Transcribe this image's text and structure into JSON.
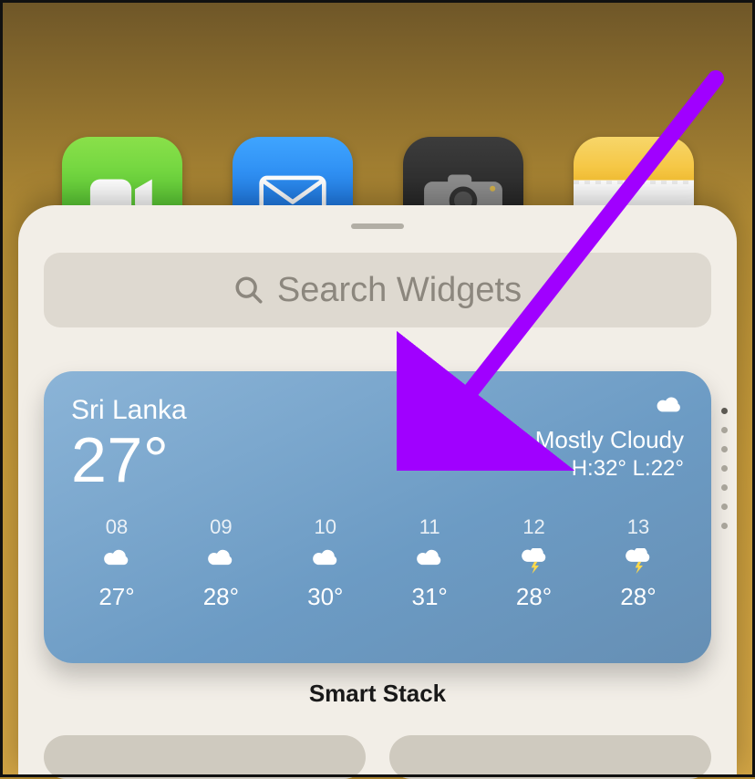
{
  "apps": {
    "facetime": "facetime-icon",
    "mail": "mail-icon",
    "camera": "camera-icon",
    "notes": "notes-icon"
  },
  "search": {
    "placeholder": "Search Widgets"
  },
  "widget": {
    "location": "Sri Lanka",
    "temp": "27°",
    "condition_icon": "cloud",
    "condition": "Mostly Cloudy",
    "hilo": "H:32° L:22°",
    "hours": [
      {
        "label": "08",
        "icon": "cloud",
        "temp": "27°"
      },
      {
        "label": "09",
        "icon": "cloud",
        "temp": "28°"
      },
      {
        "label": "10",
        "icon": "cloud",
        "temp": "30°"
      },
      {
        "label": "11",
        "icon": "cloud",
        "temp": "31°"
      },
      {
        "label": "12",
        "icon": "storm",
        "temp": "28°"
      },
      {
        "label": "13",
        "icon": "storm",
        "temp": "28°"
      }
    ]
  },
  "stack_label": "Smart Stack",
  "dot_count": 7
}
